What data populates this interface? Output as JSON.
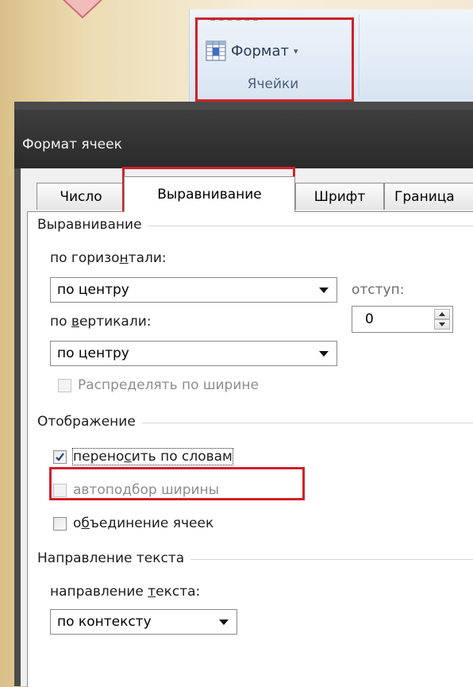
{
  "ribbon": {
    "format_button_label": "Формат",
    "format_caret": "▾",
    "group_label": "Ячейки"
  },
  "dialog": {
    "title": "Формат ячеек",
    "tabs": [
      {
        "label": "Число",
        "active": false
      },
      {
        "label": "Выравнивание",
        "active": true
      },
      {
        "label": "Шрифт",
        "active": false
      },
      {
        "label": "Граница",
        "active": false
      }
    ],
    "alignment_section": {
      "title": "Выравнивание",
      "horizontal_label_pre": "по горизо",
      "horizontal_label_ul": "н",
      "horizontal_label_post": "тали:",
      "horizontal_value": "по центру",
      "indent_label": "отступ:",
      "indent_value": "0",
      "vertical_label_pre": "по ",
      "vertical_label_ul": "в",
      "vertical_label_post": "ертикали:",
      "vertical_value": "по центру",
      "distribute_label": "Распределять по ширине"
    },
    "display_section": {
      "title": "Отображение",
      "wrap_text_pre": "перено",
      "wrap_text_ul": "с",
      "wrap_text_post": "ить по словам",
      "wrap_text_checked": true,
      "shrink_label": "автоподбор ширины",
      "merge_pre": "о",
      "merge_ul": "б",
      "merge_post": "ъединение ячеек",
      "merge_checked": false
    },
    "direction_section": {
      "title": "Направление текста",
      "label_pre": "направление ",
      "label_ul": "т",
      "label_post": "екста:",
      "value": "по контексту"
    }
  },
  "colors": {
    "highlight": "#d0202a",
    "titlebar": "#2f2f2f",
    "background": "#f3e9d3"
  }
}
